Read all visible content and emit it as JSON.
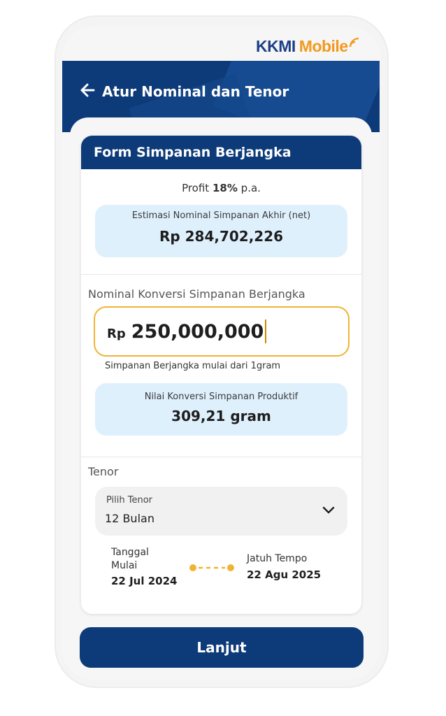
{
  "brand": {
    "kkmi": "KKMI",
    "mobile": "Mobile",
    "accent": "#f29a1d",
    "primary": "#0d3a78"
  },
  "header": {
    "title": "Atur Nominal dan Tenor",
    "back_icon": "arrow-left-icon"
  },
  "form": {
    "title": "Form Simpanan Berjangka",
    "profit": {
      "prefix": "Profit",
      "rate": "18%",
      "suffix": "p.a."
    },
    "estimate": {
      "label": "Estimasi Nominal Simpanan Akhir (net)",
      "value": "Rp 284,702,226"
    },
    "nominal": {
      "label": "Nominal Konversi Simpanan Berjangka",
      "currency": "Rp",
      "value": "250,000,000",
      "hint": "Simpanan Berjangka mulai dari 1gram"
    },
    "conversion": {
      "label": "Nilai Konversi Simpanan Produktif",
      "value": "309,21 gram"
    },
    "tenor": {
      "label": "Tenor",
      "select_label": "Pilih Tenor",
      "selected": "12 Bulan",
      "chevron_icon": "chevron-down-icon"
    },
    "dates": {
      "start_label_1": "Tanggal",
      "start_label_2": "Mulai",
      "start_value": "22 Jul 2024",
      "end_label": "Jatuh Tempo",
      "end_value": "22 Agu 2025"
    }
  },
  "cta": {
    "label": "Lanjut"
  }
}
